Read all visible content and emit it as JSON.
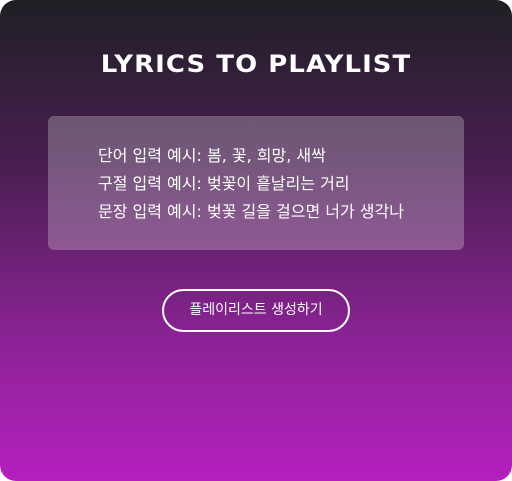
{
  "app": {
    "title": "LYRICS TO PLAYLIST"
  },
  "examples": {
    "lines": [
      "단어 입력 예시: 봄, 꽃, 희망, 새싹",
      "구절 입력 예시: 벚꽃이 흩날리는 거리",
      "문장 입력 예시: 벚꽃 길을 걸으면 너가 생각나"
    ]
  },
  "actions": {
    "generate_label": "플레이리스트 생성하기"
  }
}
